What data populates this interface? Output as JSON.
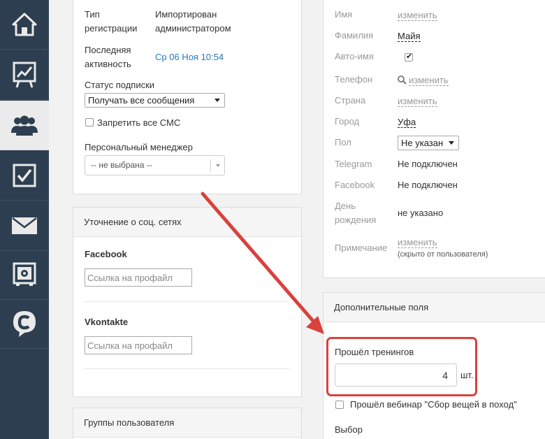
{
  "sidebar": {
    "items": [
      {
        "icon": "home-icon"
      },
      {
        "icon": "chart-icon"
      },
      {
        "icon": "users-icon",
        "active": true
      },
      {
        "icon": "tasks-icon"
      },
      {
        "icon": "mail-icon"
      },
      {
        "icon": "safe-icon"
      },
      {
        "icon": "chat-icon"
      }
    ]
  },
  "left": {
    "reg_type_label": "Тип регистрации",
    "reg_type_value": "Импортирован администратором",
    "last_activity_label": "Последняя активность",
    "last_activity_value": "Ср 06 Ноя 10:54",
    "subscription_label": "Статус подписки",
    "subscription_value": "Получать все сообщения",
    "ban_sms_label": "Запретить все СМС",
    "manager_label": "Персональный менеджер",
    "manager_value": "-- не выбрана --",
    "social": {
      "title": "Уточнение о соц. сетях",
      "facebook_label": "Facebook",
      "facebook_placeholder": "Ссылка на профайл",
      "vk_label": "Vkontakte",
      "vk_placeholder": "Ссылка на профайл"
    },
    "groups_title": "Группы пользователя"
  },
  "right": {
    "name_label": "Имя",
    "name_action": "изменить",
    "surname_label": "Фамилия",
    "surname_value": "Майя",
    "autoname_label": "Авто-имя",
    "autoname_checked": true,
    "phone_label": "Телефон",
    "phone_action": "изменить",
    "country_label": "Страна",
    "country_action": "изменить",
    "city_label": "Город",
    "city_value": "Уфа",
    "gender_label": "Пол",
    "gender_value": "Не указан",
    "telegram_label": "Telegram",
    "telegram_value": "Не подключен",
    "facebook_label": "Facebook",
    "facebook_value": "Не подключен",
    "birthday_label": "День рождения",
    "birthday_value": "не указано",
    "note_label": "Примечание",
    "note_action": "изменить",
    "note_hint": "(скрыто от пользователя)",
    "extra": {
      "title": "Дополнительные поля",
      "training_label": "Прошёл тренингов",
      "training_value": "4",
      "training_unit": "шт.",
      "webinar_label": "Прошёл вебинар \"Сбор вещей в поход\"",
      "choice_label": "Выбор"
    }
  },
  "colors": {
    "sidebar": "#2d3e50",
    "link": "#2a7ab7",
    "highlight": "#d9413c"
  }
}
